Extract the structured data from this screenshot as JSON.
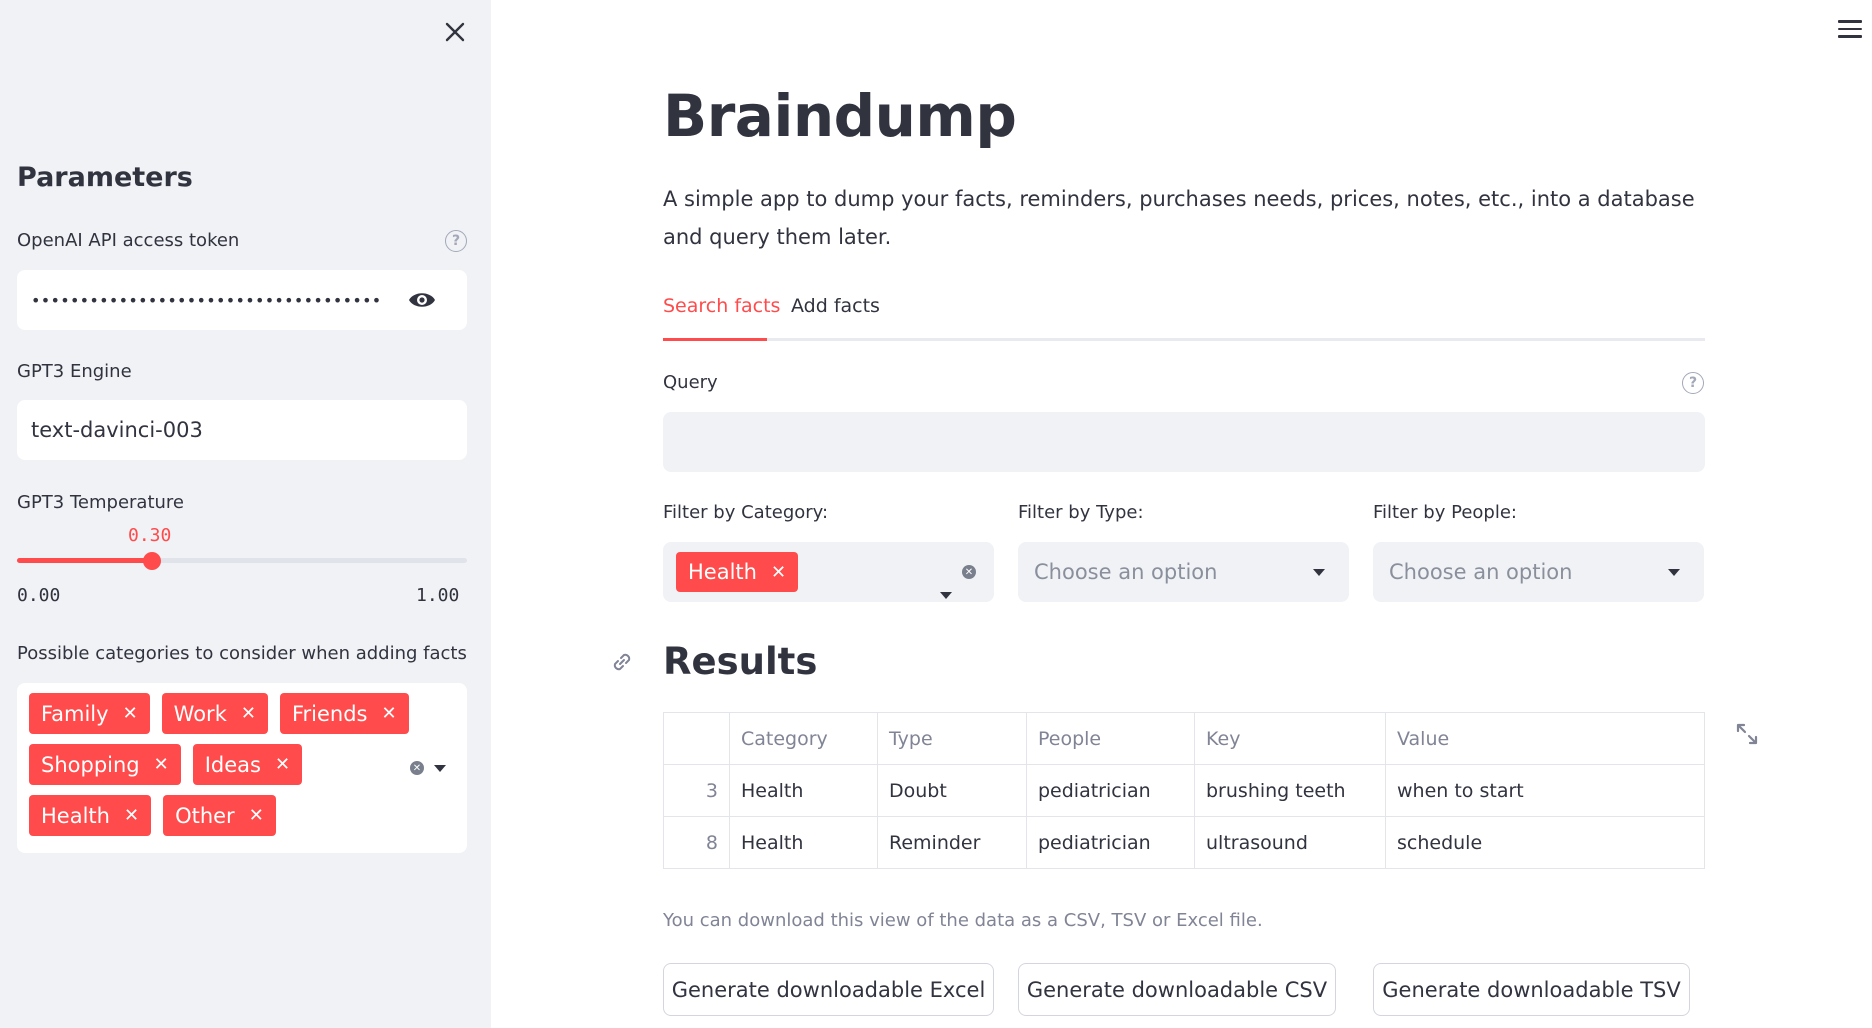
{
  "sidebar": {
    "title": "Parameters",
    "api_token": {
      "label": "OpenAI API access token",
      "value": "••••••••••••••••••••••••••••••••••••••••••••••••••••••"
    },
    "engine": {
      "label": "GPT3 Engine",
      "value": "text-davinci-003"
    },
    "temperature": {
      "label": "GPT3 Temperature",
      "value": "0.30",
      "fraction": 0.3,
      "min": "0.00",
      "max": "1.00"
    },
    "categories": {
      "label": "Possible categories to consider when adding facts",
      "tags": [
        "Family",
        "Work",
        "Friends",
        "Shopping",
        "Ideas",
        "Health",
        "Other"
      ]
    }
  },
  "main": {
    "title": "Braindump",
    "subtitle": "A simple app to dump your facts, reminders, purchases needs, prices, notes, etc., into a database and query them later.",
    "tabs": [
      {
        "label": "Search facts",
        "active": true
      },
      {
        "label": "Add facts",
        "active": false
      }
    ],
    "query": {
      "label": "Query",
      "value": ""
    },
    "filters": {
      "category": {
        "label": "Filter by Category:",
        "selected": "Health"
      },
      "type": {
        "label": "Filter by Type:",
        "placeholder": "Choose an option"
      },
      "people": {
        "label": "Filter by People:",
        "placeholder": "Choose an option"
      }
    },
    "results": {
      "title": "Results",
      "columns": [
        "",
        "Category",
        "Type",
        "People",
        "Key",
        "Value"
      ],
      "rows": [
        [
          "3",
          "Health",
          "Doubt",
          "pediatrician",
          "brushing teeth",
          "when to start"
        ],
        [
          "8",
          "Health",
          "Reminder",
          "pediatrician",
          "ultrasound",
          "schedule"
        ]
      ]
    },
    "download_note": "You can download this view of the data as a CSV, TSV or Excel file.",
    "buttons": {
      "excel": "Generate downloadable Excel",
      "csv": "Generate downloadable CSV",
      "tsv": "Generate downloadable TSV"
    }
  },
  "colors": {
    "accent": "#ff4b4b",
    "sidebar_bg": "#f0f2f6",
    "text": "#31333f",
    "muted": "#808495"
  },
  "icons": {
    "close": "close-icon",
    "help": "help-icon",
    "eye": "eye-icon",
    "menu": "hamburger-menu-icon",
    "link": "link-icon",
    "expand": "expand-icon"
  }
}
